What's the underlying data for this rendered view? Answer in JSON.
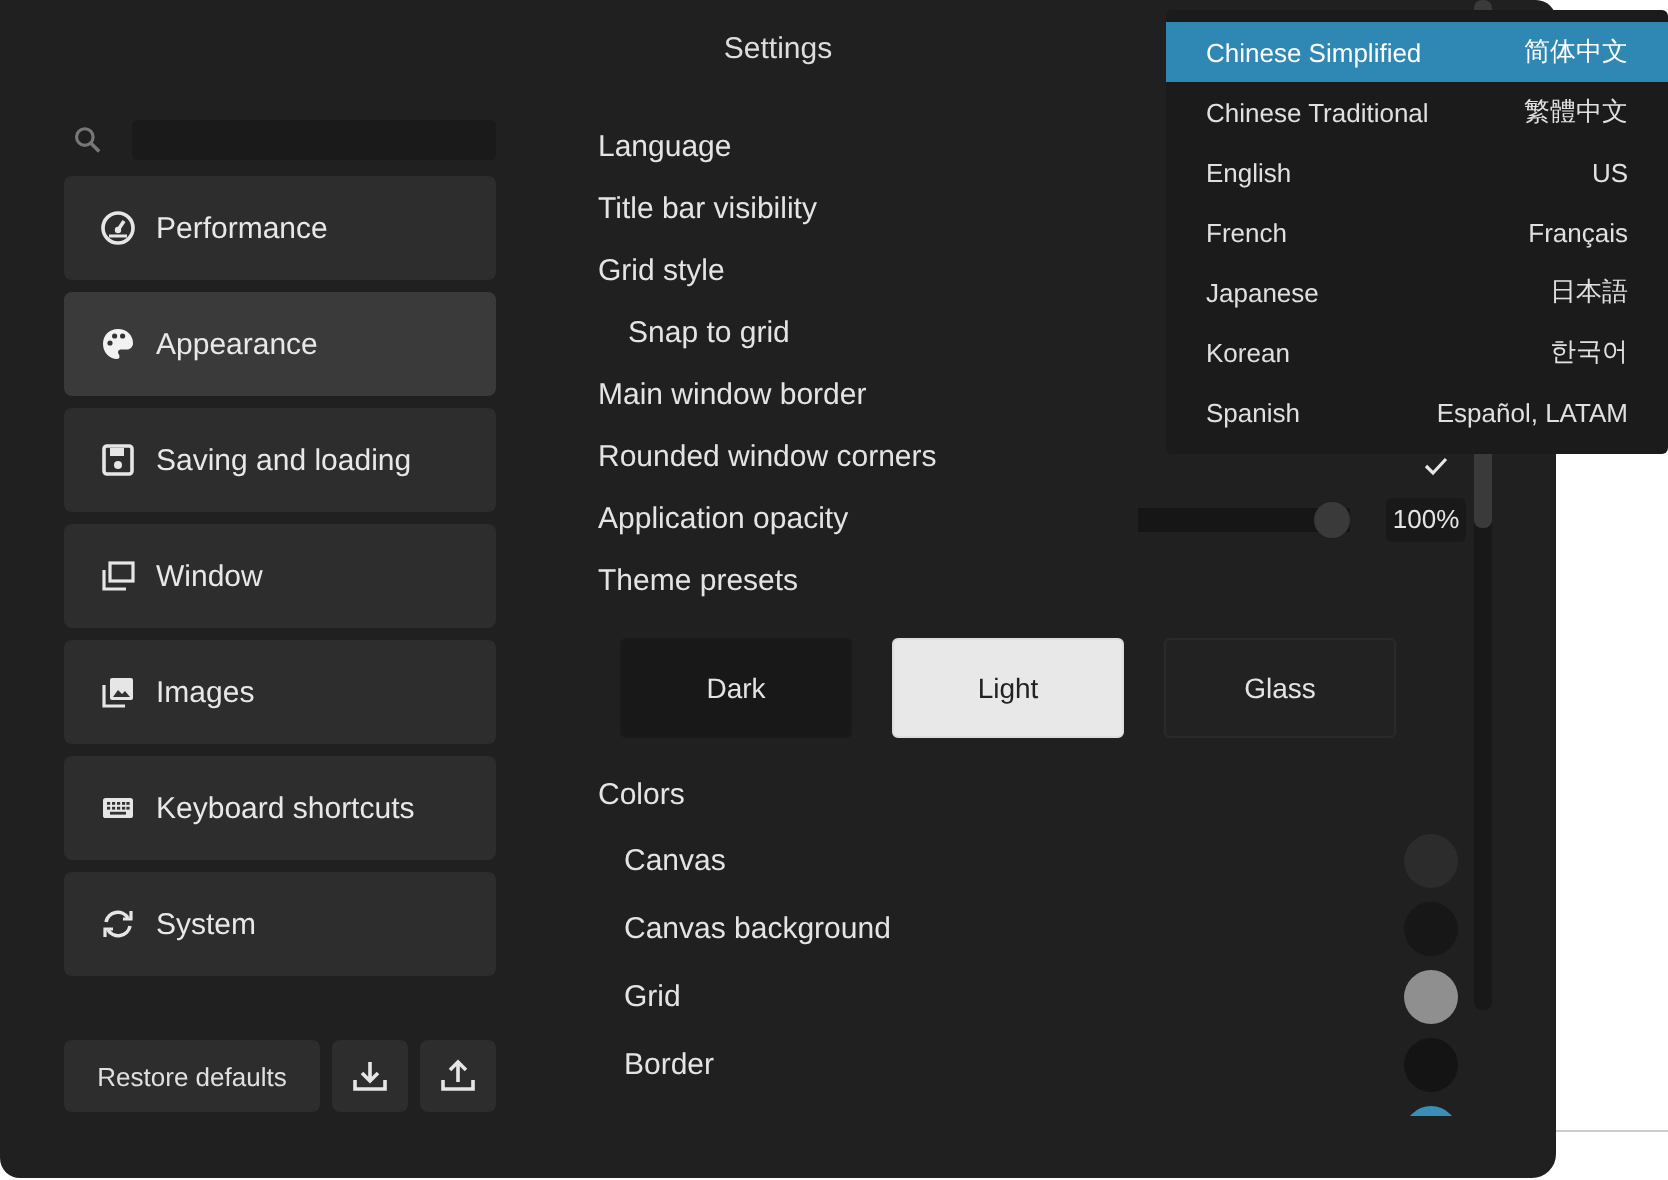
{
  "window": {
    "title": "Settings"
  },
  "sidebar": {
    "items": [
      {
        "label": "Performance",
        "selected": false
      },
      {
        "label": "Appearance",
        "selected": true
      },
      {
        "label": "Saving and loading",
        "selected": false
      },
      {
        "label": "Window",
        "selected": false
      },
      {
        "label": "Images",
        "selected": false
      },
      {
        "label": "Keyboard shortcuts",
        "selected": false
      },
      {
        "label": "System",
        "selected": false
      }
    ]
  },
  "restore_button": "Restore defaults",
  "settings": [
    {
      "label": "Language",
      "kind": "plain"
    },
    {
      "label": "Title bar visibility",
      "kind": "plain"
    },
    {
      "label": "Grid style",
      "kind": "plain",
      "children": [
        {
          "label": "Snap to grid"
        }
      ]
    },
    {
      "label": "Main window border",
      "kind": "plain"
    },
    {
      "label": "Rounded window corners",
      "kind": "checkbox",
      "checked": true
    },
    {
      "label": "Application opacity",
      "kind": "slider",
      "level": 1,
      "reading": "100%"
    },
    {
      "label": "Theme presets",
      "kind": "presets",
      "options": [
        {
          "label": "Dark",
          "kind": "dark"
        },
        {
          "label": "Light",
          "kind": "light"
        },
        {
          "label": "Glass",
          "kind": "glass"
        }
      ]
    },
    {
      "label": "Colors",
      "kind": "colors",
      "children": [
        {
          "label": "Canvas",
          "color": "#2c2c2c"
        },
        {
          "label": "Canvas background",
          "color": "#171717"
        },
        {
          "label": "Grid",
          "color": "#8f8f8f"
        },
        {
          "label": "Border",
          "color": "#141414"
        },
        {
          "color": "#3a8fb7"
        }
      ]
    }
  ],
  "language_menu": {
    "items": [
      {
        "name": "Chinese Simplified",
        "native": "简体中文",
        "selected": true
      },
      {
        "name": "Chinese Traditional",
        "native": "繁體中文",
        "selected": false
      },
      {
        "name": "English",
        "native": "US",
        "selected": false
      },
      {
        "name": "French",
        "native": "Français",
        "selected": false
      },
      {
        "name": "Japanese",
        "native": "日本語",
        "selected": false
      },
      {
        "name": "Korean",
        "native": "한국어",
        "selected": false
      },
      {
        "name": "Spanish",
        "native": "Español, LATAM",
        "selected": false
      }
    ]
  }
}
